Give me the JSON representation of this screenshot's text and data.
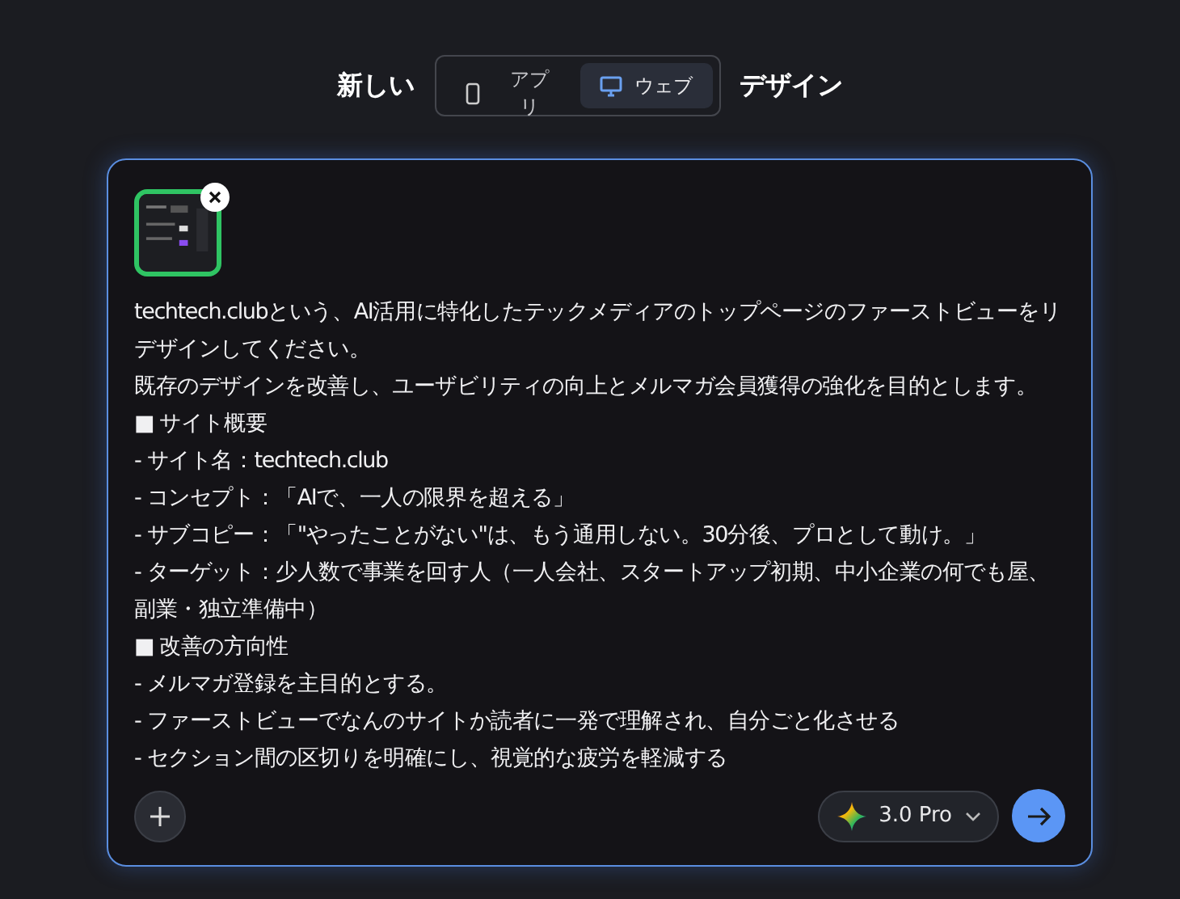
{
  "header": {
    "prefix": "新しい",
    "suffix": "デザイン"
  },
  "mode_toggle": [
    {
      "label": "アプリ",
      "kind": "phone",
      "selected": false
    },
    {
      "label": "ウェブ",
      "kind": "desktop",
      "selected": true
    }
  ],
  "prompt": {
    "attachment": {
      "kind": "screenshot"
    },
    "lines": [
      "techtech.clubという、AI活用に特化したテックメディアのトップページのファーストビューをリデザインしてください。",
      "既存のデザインを改善し、ユーザビリティの向上とメルマガ会員獲得の強化を目的とします。",
      "■ サイト概要",
      "- サイト名：techtech.club",
      "- コンセプト：「AIで、一人の限界を超える」",
      "- サブコピー：「\"やったことがない\"は、もう通用しない。30分後、プロとして動け。」",
      "- ターゲット：少人数で事業を回す人（一人会社、スタートアップ初期、中小企業の何でも屋、副業・独立準備中）",
      "■ 改善の方向性",
      "- メルマガ登録を主目的とする。",
      "- ファーストビューでなんのサイトか読者に一発で理解され、自分ごと化させる",
      "- セクション間の区切りを明確にし、視覚的な疲労を軽減する"
    ]
  },
  "model_selector": {
    "label": "3.0 Pro"
  }
}
